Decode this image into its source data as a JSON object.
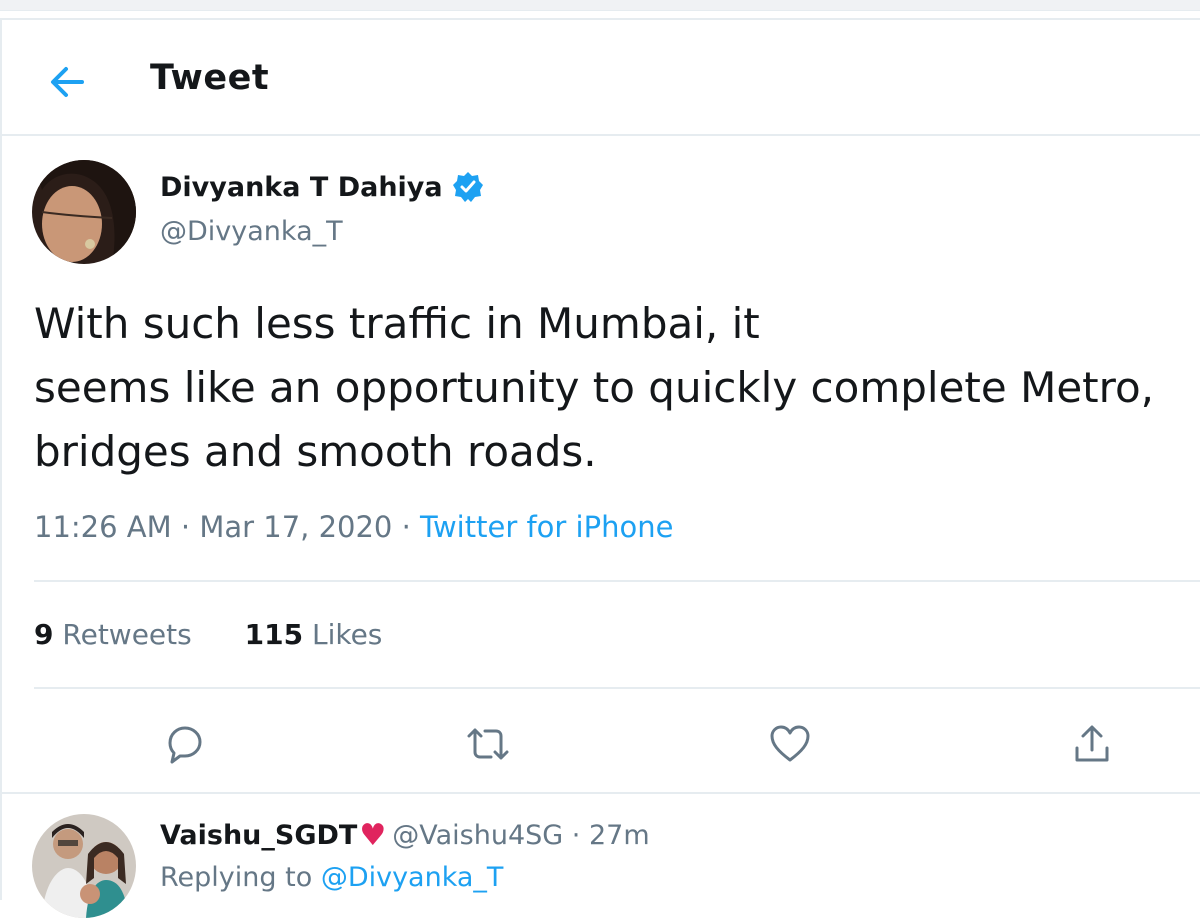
{
  "header": {
    "title": "Tweet"
  },
  "tweet": {
    "author_name": "Divyanka T Dahiya",
    "author_handle": "@Divyanka_T",
    "text": "With such less traffic in Mumbai, it\nseems like an opportunity to quickly complete Metro,\nbridges and smooth roads.",
    "time": "11:26 AM",
    "date": "Mar 17, 2020",
    "source": "Twitter for iPhone",
    "retweets_count": "9",
    "retweets_label": "Retweets",
    "likes_count": "115",
    "likes_label": "Likes"
  },
  "actions": [
    "comment-icon",
    "retweet-icon",
    "heart-icon",
    "share-icon"
  ],
  "reply": {
    "name": "Vaishu_SGDT",
    "handle": "@Vaishu4SG",
    "age": "27m",
    "replying_prefix": "Replying to",
    "replying_to": "@Divyanka_T"
  },
  "colors": {
    "accent": "#1da1f2",
    "secondary_text": "#657786",
    "verified": "#1da1f2",
    "heart": "#e0245e"
  }
}
